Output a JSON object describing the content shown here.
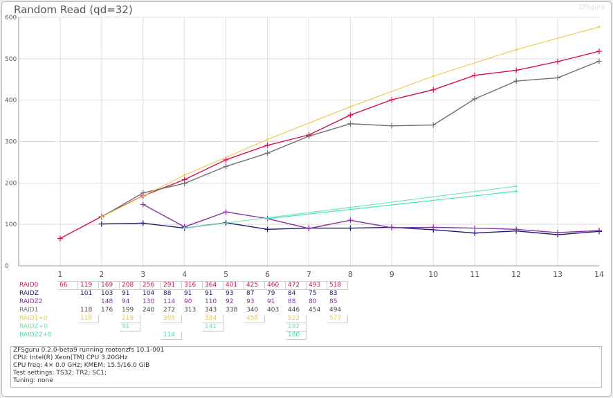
{
  "header": {
    "title": "Random Read (qd=32)",
    "watermark": "ZFSguru"
  },
  "chart_data": {
    "type": "line",
    "title": "Random Read (qd=32)",
    "xlabel": "",
    "ylabel": "",
    "x": [
      1,
      2,
      3,
      4,
      5,
      6,
      7,
      8,
      9,
      10,
      11,
      12,
      13,
      14
    ],
    "xlim": [
      0,
      14
    ],
    "ylim": [
      0,
      600
    ],
    "yticks": [
      0,
      100,
      200,
      300,
      400,
      500,
      600
    ],
    "grid": true,
    "legend": "table-below",
    "series": [
      {
        "name": "RAID0",
        "color": "#d6104e",
        "marker": "plus",
        "values": [
          66,
          119,
          169,
          208,
          256,
          291,
          316,
          364,
          401,
          425,
          460,
          472,
          493,
          518
        ]
      },
      {
        "name": "RAIDZ",
        "color": "#1a1a6e",
        "marker": "plus",
        "values": [
          null,
          101,
          103,
          91,
          104,
          88,
          91,
          91,
          93,
          87,
          79,
          84,
          75,
          83
        ]
      },
      {
        "name": "RAIDZ2",
        "color": "#8a30a8",
        "marker": "plus",
        "values": [
          null,
          null,
          148,
          94,
          130,
          114,
          90,
          110,
          92,
          93,
          91,
          88,
          80,
          85
        ]
      },
      {
        "name": "RAID1",
        "color": "#707070",
        "marker": "plus",
        "values": [
          null,
          118,
          176,
          199,
          240,
          272,
          313,
          343,
          338,
          340,
          403,
          446,
          454,
          494
        ]
      },
      {
        "name": "RAID1+0",
        "color": "#ecc94b",
        "marker": "tick",
        "values": [
          null,
          118,
          null,
          219,
          null,
          305,
          null,
          384,
          null,
          458,
          null,
          522,
          null,
          577
        ]
      },
      {
        "name": "RAIDZ+0",
        "color": "#6ee8a8",
        "marker": "tick",
        "values": [
          null,
          null,
          null,
          91,
          null,
          null,
          null,
          141,
          null,
          null,
          null,
          192,
          null,
          null
        ]
      },
      {
        "name": "RAIDZ2+0",
        "color": "#30e8a8",
        "marker": "tick",
        "values": [
          null,
          null,
          null,
          null,
          null,
          114,
          null,
          null,
          null,
          null,
          null,
          180,
          null,
          null
        ]
      }
    ]
  },
  "info": {
    "lines": [
      "ZFSguru 0.2.0-beta9 running rootonzfs 10.1-001",
      "CPU: Intel(R) Xeon(TM) CPU 3.20GHz",
      "CPU freq: 4× 0.0 GHz; KMEM: 15.5/16.0 GiB",
      "Test settings: TS32; TR2; SC1;",
      "Tuning: none"
    ]
  }
}
